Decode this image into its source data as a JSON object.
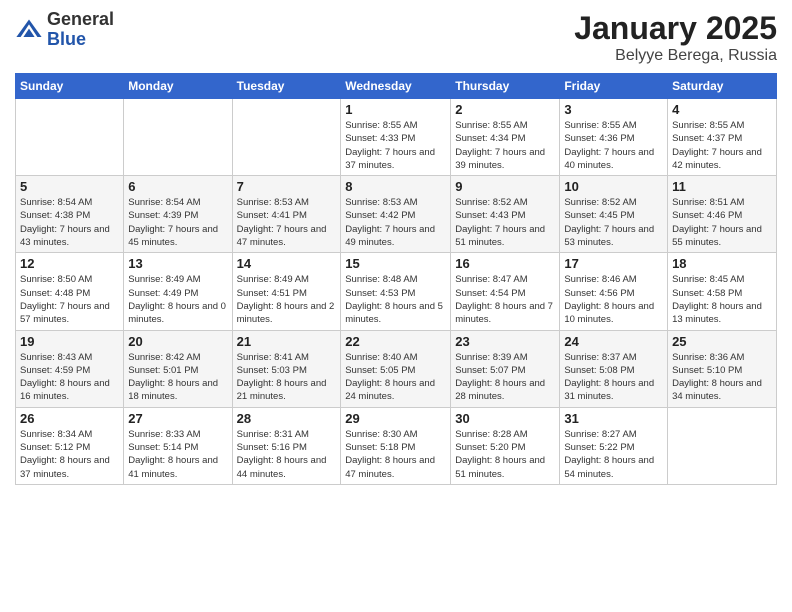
{
  "header": {
    "logo_general": "General",
    "logo_blue": "Blue",
    "month": "January 2025",
    "location": "Belyye Berega, Russia"
  },
  "weekdays": [
    "Sunday",
    "Monday",
    "Tuesday",
    "Wednesday",
    "Thursday",
    "Friday",
    "Saturday"
  ],
  "weeks": [
    [
      {
        "day": "",
        "info": ""
      },
      {
        "day": "",
        "info": ""
      },
      {
        "day": "",
        "info": ""
      },
      {
        "day": "1",
        "info": "Sunrise: 8:55 AM\nSunset: 4:33 PM\nDaylight: 7 hours and 37 minutes."
      },
      {
        "day": "2",
        "info": "Sunrise: 8:55 AM\nSunset: 4:34 PM\nDaylight: 7 hours and 39 minutes."
      },
      {
        "day": "3",
        "info": "Sunrise: 8:55 AM\nSunset: 4:36 PM\nDaylight: 7 hours and 40 minutes."
      },
      {
        "day": "4",
        "info": "Sunrise: 8:55 AM\nSunset: 4:37 PM\nDaylight: 7 hours and 42 minutes."
      }
    ],
    [
      {
        "day": "5",
        "info": "Sunrise: 8:54 AM\nSunset: 4:38 PM\nDaylight: 7 hours and 43 minutes."
      },
      {
        "day": "6",
        "info": "Sunrise: 8:54 AM\nSunset: 4:39 PM\nDaylight: 7 hours and 45 minutes."
      },
      {
        "day": "7",
        "info": "Sunrise: 8:53 AM\nSunset: 4:41 PM\nDaylight: 7 hours and 47 minutes."
      },
      {
        "day": "8",
        "info": "Sunrise: 8:53 AM\nSunset: 4:42 PM\nDaylight: 7 hours and 49 minutes."
      },
      {
        "day": "9",
        "info": "Sunrise: 8:52 AM\nSunset: 4:43 PM\nDaylight: 7 hours and 51 minutes."
      },
      {
        "day": "10",
        "info": "Sunrise: 8:52 AM\nSunset: 4:45 PM\nDaylight: 7 hours and 53 minutes."
      },
      {
        "day": "11",
        "info": "Sunrise: 8:51 AM\nSunset: 4:46 PM\nDaylight: 7 hours and 55 minutes."
      }
    ],
    [
      {
        "day": "12",
        "info": "Sunrise: 8:50 AM\nSunset: 4:48 PM\nDaylight: 7 hours and 57 minutes."
      },
      {
        "day": "13",
        "info": "Sunrise: 8:49 AM\nSunset: 4:49 PM\nDaylight: 8 hours and 0 minutes."
      },
      {
        "day": "14",
        "info": "Sunrise: 8:49 AM\nSunset: 4:51 PM\nDaylight: 8 hours and 2 minutes."
      },
      {
        "day": "15",
        "info": "Sunrise: 8:48 AM\nSunset: 4:53 PM\nDaylight: 8 hours and 5 minutes."
      },
      {
        "day": "16",
        "info": "Sunrise: 8:47 AM\nSunset: 4:54 PM\nDaylight: 8 hours and 7 minutes."
      },
      {
        "day": "17",
        "info": "Sunrise: 8:46 AM\nSunset: 4:56 PM\nDaylight: 8 hours and 10 minutes."
      },
      {
        "day": "18",
        "info": "Sunrise: 8:45 AM\nSunset: 4:58 PM\nDaylight: 8 hours and 13 minutes."
      }
    ],
    [
      {
        "day": "19",
        "info": "Sunrise: 8:43 AM\nSunset: 4:59 PM\nDaylight: 8 hours and 16 minutes."
      },
      {
        "day": "20",
        "info": "Sunrise: 8:42 AM\nSunset: 5:01 PM\nDaylight: 8 hours and 18 minutes."
      },
      {
        "day": "21",
        "info": "Sunrise: 8:41 AM\nSunset: 5:03 PM\nDaylight: 8 hours and 21 minutes."
      },
      {
        "day": "22",
        "info": "Sunrise: 8:40 AM\nSunset: 5:05 PM\nDaylight: 8 hours and 24 minutes."
      },
      {
        "day": "23",
        "info": "Sunrise: 8:39 AM\nSunset: 5:07 PM\nDaylight: 8 hours and 28 minutes."
      },
      {
        "day": "24",
        "info": "Sunrise: 8:37 AM\nSunset: 5:08 PM\nDaylight: 8 hours and 31 minutes."
      },
      {
        "day": "25",
        "info": "Sunrise: 8:36 AM\nSunset: 5:10 PM\nDaylight: 8 hours and 34 minutes."
      }
    ],
    [
      {
        "day": "26",
        "info": "Sunrise: 8:34 AM\nSunset: 5:12 PM\nDaylight: 8 hours and 37 minutes."
      },
      {
        "day": "27",
        "info": "Sunrise: 8:33 AM\nSunset: 5:14 PM\nDaylight: 8 hours and 41 minutes."
      },
      {
        "day": "28",
        "info": "Sunrise: 8:31 AM\nSunset: 5:16 PM\nDaylight: 8 hours and 44 minutes."
      },
      {
        "day": "29",
        "info": "Sunrise: 8:30 AM\nSunset: 5:18 PM\nDaylight: 8 hours and 47 minutes."
      },
      {
        "day": "30",
        "info": "Sunrise: 8:28 AM\nSunset: 5:20 PM\nDaylight: 8 hours and 51 minutes."
      },
      {
        "day": "31",
        "info": "Sunrise: 8:27 AM\nSunset: 5:22 PM\nDaylight: 8 hours and 54 minutes."
      },
      {
        "day": "",
        "info": ""
      }
    ]
  ]
}
